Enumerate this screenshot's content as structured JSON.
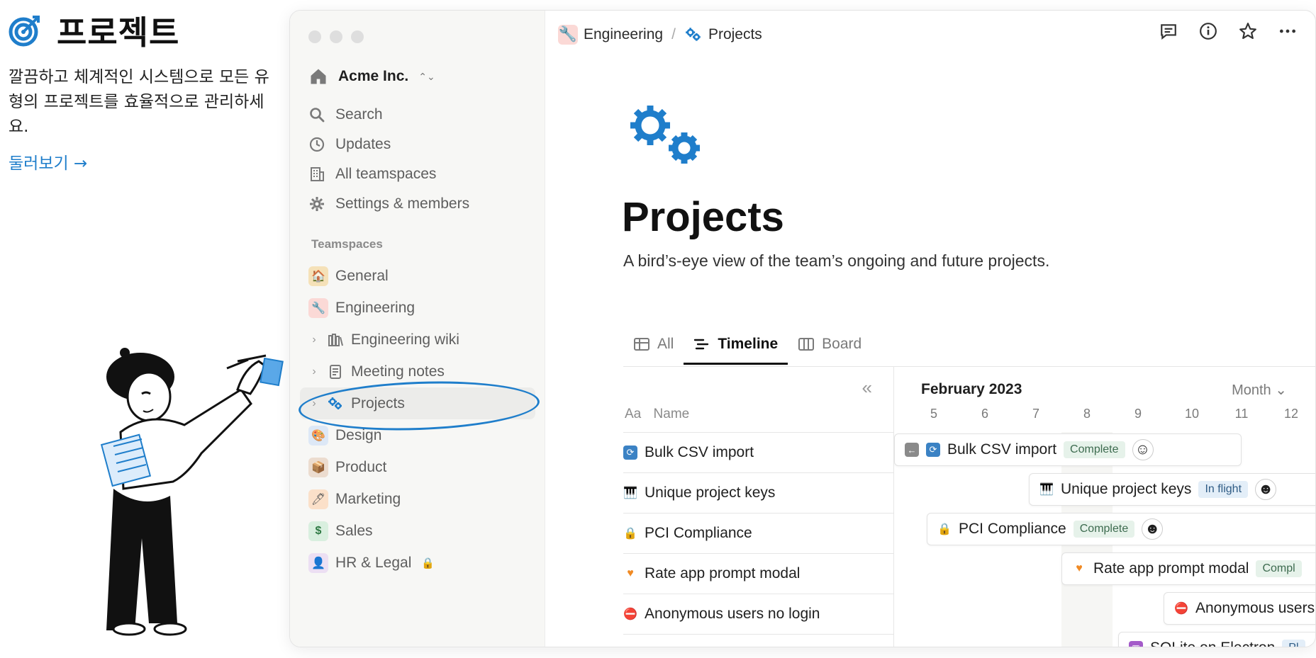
{
  "promo": {
    "title": "프로젝트",
    "description": "깔끔하고 체계적인 시스템으로 모든 유형의 프로젝트를 효율적으로 관리하세요.",
    "link": "둘러보기 →"
  },
  "sidebar": {
    "workspace": "Acme Inc.",
    "nav": [
      {
        "label": "Search",
        "icon": "search-icon"
      },
      {
        "label": "Updates",
        "icon": "clock-icon"
      },
      {
        "label": "All teamspaces",
        "icon": "building-icon"
      },
      {
        "label": "Settings & members",
        "icon": "gear-icon"
      }
    ],
    "section_label": "Teamspaces",
    "teams": [
      {
        "label": "General",
        "icon": "house-icon",
        "color": "#f5e1b8"
      },
      {
        "label": "Engineering",
        "icon": "wrench-icon",
        "color": "#fbd9d6"
      },
      {
        "label": "Engineering wiki",
        "icon": "books-icon"
      },
      {
        "label": "Meeting notes",
        "icon": "notebook-icon"
      },
      {
        "label": "Projects",
        "icon": "gears-icon"
      },
      {
        "label": "Design",
        "icon": "palette-icon",
        "color": "#dde8f6"
      },
      {
        "label": "Product",
        "icon": "box-icon",
        "color": "#ecdccf"
      },
      {
        "label": "Marketing",
        "icon": "pen-icon",
        "color": "#fbe0c9"
      },
      {
        "label": "Sales",
        "icon": "dollar-icon",
        "color": "#d9efdf"
      },
      {
        "label": "HR & Legal",
        "icon": "person-icon",
        "color": "#ecdff3"
      }
    ]
  },
  "topbar": {
    "crumb1": "Engineering",
    "crumb_sep": "/",
    "crumb2": "Projects"
  },
  "page": {
    "title": "Projects",
    "description": "A bird’s-eye view of the team’s ongoing and future projects."
  },
  "tabs": [
    {
      "label": "All"
    },
    {
      "label": "Timeline"
    },
    {
      "label": "Board"
    }
  ],
  "timeline": {
    "name_prefix": "Aa",
    "name_header": "Name",
    "month": "February 2023",
    "view": "Month",
    "days": [
      "5",
      "6",
      "7",
      "8",
      "9",
      "10",
      "11",
      "12"
    ],
    "rows": [
      {
        "name": "Bulk CSV import",
        "icon": "sync-icon",
        "status": "Complete"
      },
      {
        "name": "Unique project keys",
        "icon": "piano-icon",
        "status": "In flight"
      },
      {
        "name": "PCI Compliance",
        "icon": "lock-icon",
        "status": "Complete"
      },
      {
        "name": "Rate app prompt modal",
        "icon": "heart-icon",
        "status": "Compl"
      },
      {
        "name": "Anonymous users no login",
        "icon": "no-entry-icon",
        "bar_name": "Anonymous users"
      },
      {
        "name": "SQLite on Electron",
        "icon": "package-icon",
        "status": "Pl"
      }
    ]
  }
}
